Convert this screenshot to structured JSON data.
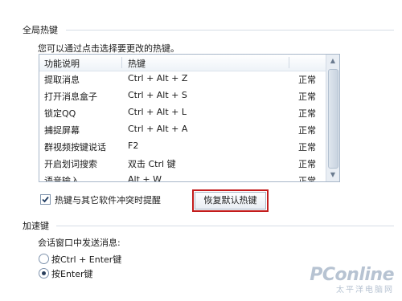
{
  "global_hotkeys": {
    "section_title": "全局热键",
    "hint": "您可以通过点击选择要更改的热键。",
    "columns": [
      "功能说明",
      "热键",
      ""
    ],
    "rows": [
      {
        "function": "提取消息",
        "hotkey": "Ctrl + Alt + Z",
        "status": "正常"
      },
      {
        "function": "打开消息盒子",
        "hotkey": "Ctrl + Alt + S",
        "status": "正常"
      },
      {
        "function": "锁定QQ",
        "hotkey": "Ctrl + Alt + L",
        "status": "正常"
      },
      {
        "function": "捕捉屏幕",
        "hotkey": "Ctrl + Alt + A",
        "status": "正常"
      },
      {
        "function": "群视频按键说话",
        "hotkey": "F2",
        "status": "正常"
      },
      {
        "function": "开启划词搜索",
        "hotkey": "双击 Ctrl 键",
        "status": "正常"
      },
      {
        "function": "语音输入",
        "hotkey": "Alt + W",
        "status": "正常"
      }
    ],
    "conflict_checkbox": {
      "label": "热键与其它软件冲突时提醒",
      "checked": true
    },
    "restore_button_label": "恢复默认热键"
  },
  "accelerator": {
    "section_title": "加速键",
    "send_label": "会话窗口中发送消息:",
    "options": [
      {
        "label": "按Ctrl + Enter键",
        "selected": false
      },
      {
        "label": "按Enter键",
        "selected": true
      }
    ]
  },
  "watermark": {
    "main": "PConline",
    "sub": "太平洋电脑网"
  },
  "colors": {
    "highlight_border": "#c31c1c",
    "line": "#d6dde6"
  }
}
